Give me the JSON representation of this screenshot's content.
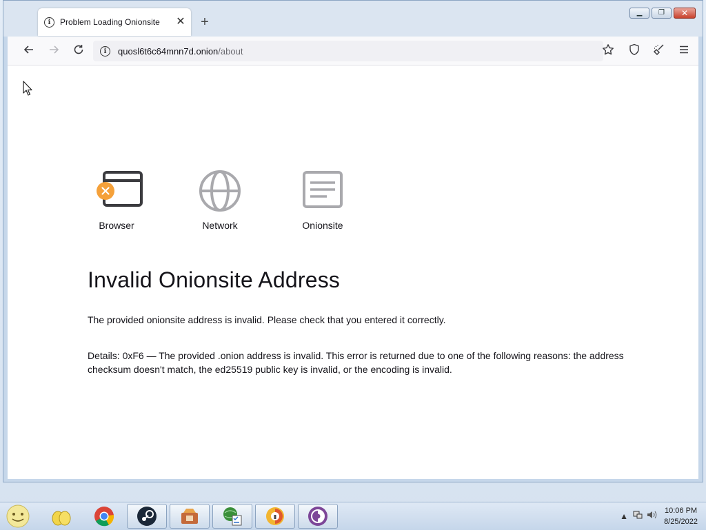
{
  "tab": {
    "title": "Problem Loading Onionsite",
    "close_icon": "close-icon",
    "new_tab_icon": "plus-icon"
  },
  "window_controls": [
    "minimize",
    "maximize",
    "close"
  ],
  "url": {
    "host": "quosl6t6c64mnn7d.onion",
    "path": "/about"
  },
  "stages": [
    {
      "label": "Browser",
      "icon": "browser-window-icon",
      "status": "error"
    },
    {
      "label": "Network",
      "icon": "globe-icon",
      "status": "ok"
    },
    {
      "label": "Onionsite",
      "icon": "document-icon",
      "status": "ok"
    }
  ],
  "error": {
    "title": "Invalid Onionsite Address",
    "description": "The provided onionsite address is invalid. Please check that you entered it correctly.",
    "details": "Details: 0xF6 — The provided .onion address is invalid. This error is returned due to one of the following reasons: the address checksum doesn't match, the ed25519 public key is invalid, or the encoding is invalid."
  },
  "colors": {
    "error_badge": "#f5a13a",
    "icon_gray": "#a9a9ad",
    "icon_dark": "#3b3b3f"
  },
  "taskbar": {
    "items": [
      "start-orb",
      "file-explorer",
      "chrome",
      "steam",
      "app-store",
      "internet-explorer",
      "antivirus",
      "tor-browser"
    ],
    "time": "10:06 PM",
    "date": "8/25/2022"
  }
}
